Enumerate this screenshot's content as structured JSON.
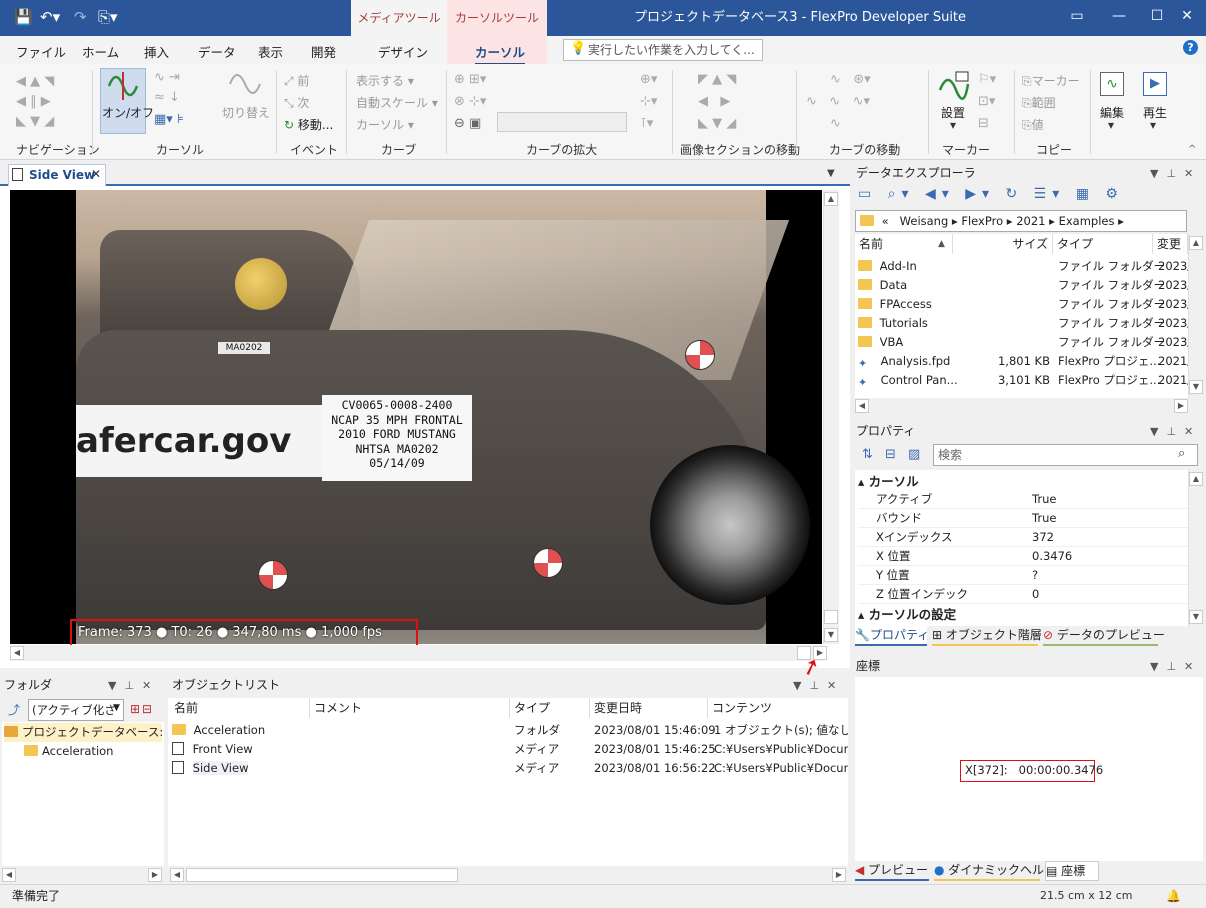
{
  "window": {
    "title": "プロジェクトデータベース3 - FlexPro Developer Suite",
    "context_media": "メディアツール",
    "context_cursor": "カーソルツール"
  },
  "ribbon_tabs": [
    "ファイル",
    "ホーム",
    "挿入",
    "データ",
    "表示",
    "開発",
    "デザイン",
    "カーソル"
  ],
  "tell_me": {
    "placeholder": "実行したい作業を入力してく..."
  },
  "ribbon": {
    "groups": [
      "ナビゲーション",
      "カーソル",
      "イベント",
      "カーブ",
      "カーブの拡大",
      "画像セクションの移動",
      "カーブの移動",
      "マーカー",
      "コピー"
    ],
    "cursor_onoff": "オン/オフ",
    "switch": "切り替え",
    "prev": "前",
    "next": "次",
    "move": "移動...",
    "show": "表示する",
    "autoscale": "自動スケール",
    "cursor_dd": "カーソル",
    "marker": "マーカー",
    "range": "範囲",
    "value": "値",
    "settings": "設置",
    "edit": "編集",
    "play": "再生"
  },
  "document_tab": {
    "label": "Side View"
  },
  "video": {
    "logo_text": "afercar.gov",
    "sign_lines": [
      "CV0065-0008-2400",
      "NCAP 35 MPH FRONTAL",
      "2010 FORD MUSTANG",
      "NHTSA MA0202",
      "05/14/09"
    ],
    "tag": "MA0202",
    "overlay": "Frame: 373 ● T0: 26 ● 347,80 ms ● 1,000 fps"
  },
  "data_explorer": {
    "title": "データエクスプローラ",
    "breadcrumb": [
      "«",
      "Weisang",
      "FlexPro",
      "2021",
      "Examples"
    ],
    "columns": [
      "名前",
      "サイズ",
      "タイプ",
      "変更"
    ],
    "rows": [
      {
        "name": "Add-In",
        "size": "",
        "type": "ファイル フォルダー",
        "date": "2023/"
      },
      {
        "name": "Data",
        "size": "",
        "type": "ファイル フォルダー",
        "date": "2023/"
      },
      {
        "name": "FPAccess",
        "size": "",
        "type": "ファイル フォルダー",
        "date": "2023/"
      },
      {
        "name": "Tutorials",
        "size": "",
        "type": "ファイル フォルダー",
        "date": "2023/"
      },
      {
        "name": "VBA",
        "size": "",
        "type": "ファイル フォルダー",
        "date": "2023/"
      },
      {
        "name": "Analysis.fpd",
        "size": "1,801 KB",
        "type": "FlexPro プロジェ...",
        "date": "2021/"
      },
      {
        "name": "Control Pan...",
        "size": "3,101 KB",
        "type": "FlexPro プロジェ...",
        "date": "2021/"
      }
    ]
  },
  "properties": {
    "title": "プロパティ",
    "search_placeholder": "検索",
    "section1": "カーソル",
    "rows": [
      {
        "key": "アクティブ",
        "value": "True"
      },
      {
        "key": "バウンド",
        "value": "True"
      },
      {
        "key": "Xインデックス",
        "value": "372"
      },
      {
        "key": "X 位置",
        "value": "0.3476"
      },
      {
        "key": "Y 位置",
        "value": "?"
      },
      {
        "key": "Z 位置インデック",
        "value": "0"
      }
    ],
    "section2": "カーソルの設定",
    "tabs": [
      "プロパティ",
      "オブジェクト階層",
      "データのプレビュー"
    ]
  },
  "coords": {
    "title": "座標",
    "readout": "X[372]:   00:00:00.3476",
    "tabs": [
      "プレビュー",
      "ダイナミックヘルプ",
      "座標"
    ]
  },
  "folder_panel": {
    "title": "フォルダ",
    "dropdown": "(アクティブ化さ",
    "root": "プロジェクトデータベース: 'プロジ",
    "child": "Acceleration"
  },
  "object_list": {
    "title": "オブジェクトリスト",
    "columns": [
      "名前",
      "コメント",
      "タイプ",
      "変更日時",
      "コンテンツ"
    ],
    "rows": [
      {
        "name": "Acceleration",
        "comment": "",
        "type": "フォルダ",
        "date": "2023/08/01 15:46:09",
        "content": "1 オブジェクト(s); 値なし"
      },
      {
        "name": "Front View",
        "comment": "",
        "type": "メディア",
        "date": "2023/08/01 15:46:25",
        "content": "C:¥Users¥Public¥Docume"
      },
      {
        "name": "Side View",
        "comment": "",
        "type": "メディア",
        "date": "2023/08/01 16:56:22",
        "content": "C:¥Users¥Public¥Docume"
      }
    ]
  },
  "status": {
    "left": "準備完了",
    "size": "21.5 cm x 12 cm"
  },
  "colors": {
    "titlebar": "#2b579a",
    "accent": "#3c6ab0",
    "highlight": "#d11111"
  }
}
